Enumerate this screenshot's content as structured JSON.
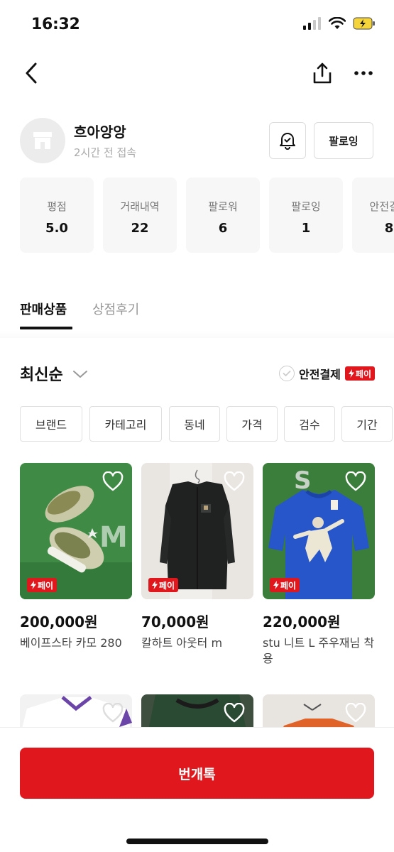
{
  "status": {
    "time": "16:32"
  },
  "nav": {
    "back_icon": "chevron-left-icon",
    "share_icon": "share-icon",
    "more_icon": "more-icon"
  },
  "profile": {
    "name": "흐아앙앙",
    "last_seen": "2시간 전 접속",
    "follow_label": "팔로잉"
  },
  "stats": [
    {
      "label": "평점",
      "value": "5.0"
    },
    {
      "label": "거래내역",
      "value": "22"
    },
    {
      "label": "팔로워",
      "value": "6"
    },
    {
      "label": "팔로잉",
      "value": "1"
    },
    {
      "label": "안전결제",
      "value": "8"
    }
  ],
  "tabs": {
    "active": "판매상품",
    "inactive": "상점후기"
  },
  "sort": {
    "label": "최신순",
    "safe_pay_label": "안전결제",
    "pay_badge": "페이"
  },
  "filters": [
    "브랜드",
    "카테고리",
    "동네",
    "가격",
    "검수",
    "기간"
  ],
  "products": [
    {
      "price": "200,000원",
      "name": "베이프스타 카모 280",
      "badge": "페이"
    },
    {
      "price": "70,000원",
      "name": "칼하트 아웃터 m",
      "badge": "페이"
    },
    {
      "price": "220,000원",
      "name": "stu 니트 L 주우재님 착용",
      "badge": "페이"
    }
  ],
  "cta": {
    "label": "번개톡"
  },
  "colors": {
    "accent": "#e1171e",
    "text": "#111111",
    "muted": "#999999"
  }
}
